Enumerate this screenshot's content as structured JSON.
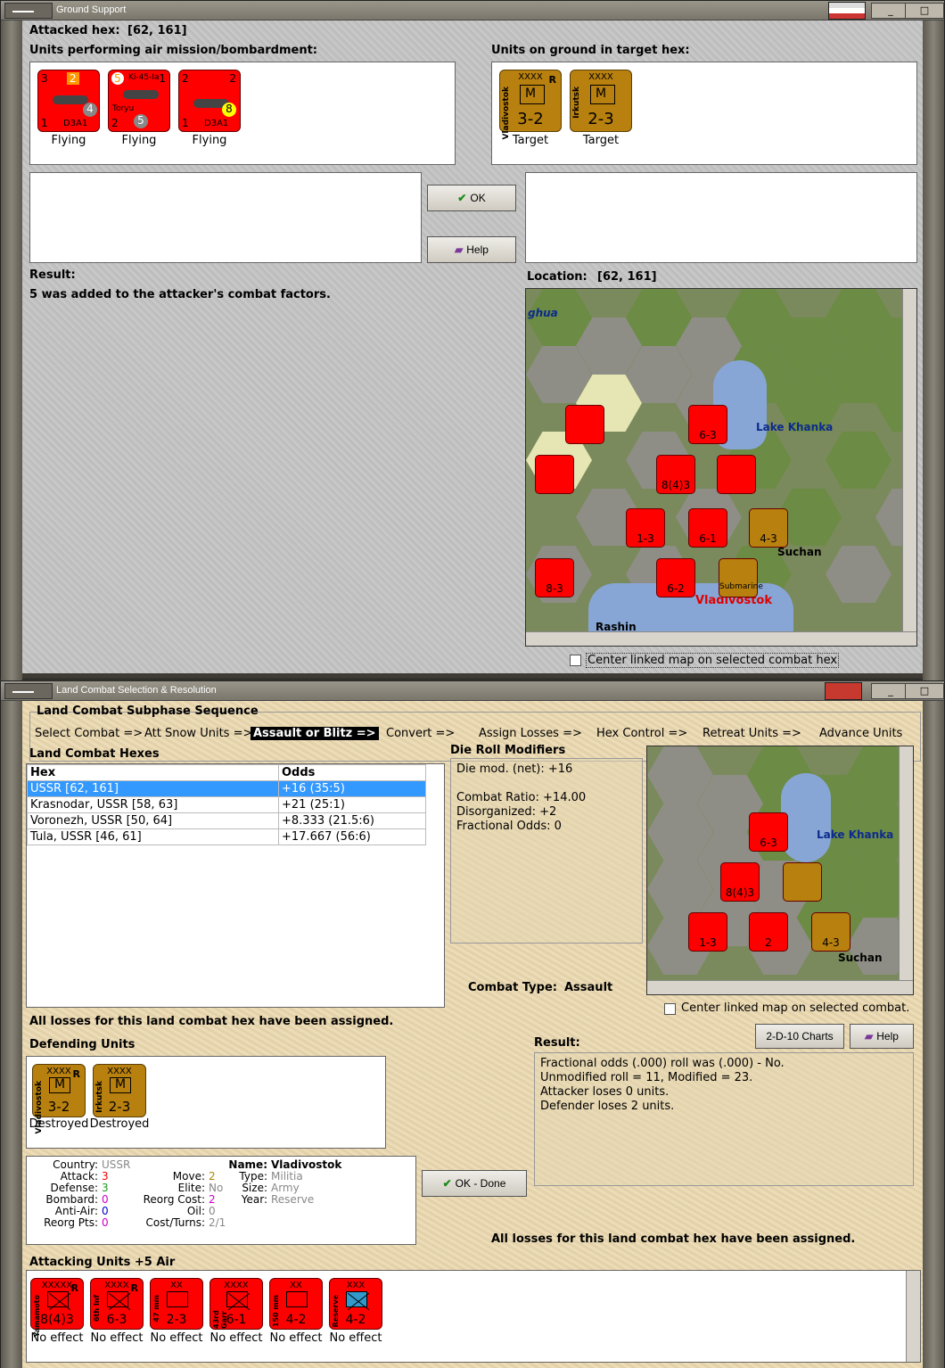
{
  "ground_support": {
    "title": "Ground Support",
    "attacked_hex_label": "Attacked hex:",
    "attacked_hex": "[62, 161]",
    "air_units_label": "Units performing air mission/bombardment:",
    "ground_units_label": "Units on ground in target hex:",
    "air_units": [
      {
        "type": "D3A1",
        "attack": "3",
        "top": "2",
        "defense": "1",
        "pips": "4",
        "caption": "Flying"
      },
      {
        "type": "Ki-45-Ia",
        "subtype": "Toryu",
        "attack": "5",
        "top": "1",
        "defense": "2",
        "pips": "5",
        "caption": "Flying"
      },
      {
        "type": "D3A1",
        "attack": "2",
        "top": "2",
        "defense": "1",
        "pips": "8",
        "caption": "Flying"
      }
    ],
    "ground_units": [
      {
        "name": "Vladivostok",
        "size": "XXXX",
        "flag": "R",
        "symbol": "M",
        "strength": "3-2",
        "caption": "Target"
      },
      {
        "name": "Irkutsk",
        "size": "XXXX",
        "flag": "",
        "symbol": "M",
        "strength": "2-3",
        "caption": "Target"
      }
    ],
    "ok_label": "OK",
    "help_label": "Help",
    "result_label": "Result:",
    "result_text": "5 was added to the attacker's combat factors.",
    "location_label": "Location:",
    "location": "[62, 161]",
    "center_map_label": "Center linked map on selected combat hex",
    "map_labels": {
      "ughua": "ghua",
      "lake": "Lake Khanka",
      "suchan": "Suchan",
      "rashin": "Rashin",
      "vladivostok": "Vladivostok"
    },
    "map_units": [
      "6-3",
      "8(4)3",
      "1-3",
      "6-1",
      "4-3",
      "8-3",
      "6-2",
      "Submarine"
    ]
  },
  "land_combat": {
    "title": "Land Combat Selection & Resolution",
    "sequence_title": "Land Combat Subphase Sequence",
    "sequence": [
      "Select Combat =>",
      "Att Snow Units =>",
      "Assault or Blitz =>",
      "Convert =>",
      "Assign Losses =>",
      "Hex Control =>",
      "Retreat Units =>",
      "Advance Units"
    ],
    "hexes_label": "Land Combat Hexes",
    "table_headers": {
      "hex": "Hex",
      "odds": "Odds"
    },
    "hexes": [
      {
        "hex": "USSR [62, 161]",
        "odds": "+16 (35:5)"
      },
      {
        "hex": "Krasnodar, USSR [58, 63]",
        "odds": "+21 (25:1)"
      },
      {
        "hex": "Voronezh, USSR [50, 64]",
        "odds": "+8.333 (21.5:6)"
      },
      {
        "hex": "Tula, USSR [46, 61]",
        "odds": "+17.667 (56:6)"
      }
    ],
    "drm_label": "Die Roll Modifiers",
    "drm": [
      "Die mod. (net): +16",
      "",
      "Combat Ratio: +14.00",
      "Disorganized: +2",
      "Fractional Odds: 0"
    ],
    "combat_type_label": "Combat Type:",
    "combat_type": "Assault",
    "center_map_label": "Center linked map on selected combat.",
    "charts_label": "2-D-10 Charts",
    "help_label": "Help",
    "losses_msg": "All losses for this land combat hex have been assigned.",
    "defending_label": "Defending Units",
    "defenders": [
      {
        "name": "Vladivostok",
        "size": "XXXX",
        "flag": "R",
        "symbol": "M",
        "strength": "3-2",
        "caption": "Destroyed"
      },
      {
        "name": "Irkutsk",
        "size": "XXXX",
        "flag": "",
        "symbol": "M",
        "strength": "2-3",
        "caption": "Destroyed"
      }
    ],
    "result_label": "Result:",
    "result": [
      "Fractional odds (.000) roll was (.000)  - No.",
      "Unmodified roll = 11, Modified = 23.",
      "Attacker loses 0 units.",
      "Defender loses 2 units."
    ],
    "info": {
      "country_k": "Country:",
      "country": "USSR",
      "attack_k": "Attack:",
      "attack": "3",
      "defense_k": "Defense:",
      "defense": "3",
      "bombard_k": "Bombard:",
      "bombard": "0",
      "antiair_k": "Anti-Air:",
      "antiair": "0",
      "reorgpts_k": "Reorg Pts:",
      "reorgpts": "0",
      "move_k": "Move:",
      "move": "2",
      "elite_k": "Elite:",
      "elite": "No",
      "reorgcost_k": "Reorg Cost:",
      "reorgcost": "2",
      "oil_k": "Oil:",
      "oil": "0",
      "costturns_k": "Cost/Turns:",
      "costturns": "2/1",
      "name_k": "Name:",
      "name": "Vladivostok",
      "type_k": "Type:",
      "type": "Militia",
      "size_k": "Size:",
      "size": "Army",
      "year_k": "Year:",
      "year": "Reserve"
    },
    "ok_done_label": "OK - Done",
    "losses_msg2": "All losses for this land combat hex have been assigned.",
    "attacking_label": "Attacking Units +5 Air",
    "attackers": [
      {
        "name": "Yamamoto",
        "size": "XXXXX",
        "flag": "R",
        "strength": "8(4)3",
        "caption": "No effect"
      },
      {
        "name": "6th Inf",
        "size": "XXXX",
        "flag": "R",
        "strength": "6-3",
        "caption": "No effect"
      },
      {
        "name": "47 mm",
        "size": "XX",
        "flag": "",
        "strength": "2-3",
        "caption": "No effect"
      },
      {
        "name": "43rd Garr",
        "size": "XXXX",
        "flag": "",
        "strength": "6-1",
        "caption": "No effect"
      },
      {
        "name": "150 mm",
        "size": "XX",
        "flag": "",
        "strength": "4-2",
        "caption": "No effect"
      },
      {
        "name": "Reserve",
        "size": "XXX",
        "flag": "",
        "strength": "4-2",
        "caption": "No effect"
      }
    ],
    "map_labels": {
      "lake": "Lake Khanka",
      "suchan": "Suchan"
    },
    "map_units": [
      "6-3",
      "8(4)3",
      "1-3",
      "2",
      "4-3"
    ]
  },
  "colors": {
    "unit_red": "#ff0000",
    "unit_brown": "#b8800e",
    "selection": "#3399ff",
    "map_text": "#0c2b8c",
    "city_text": "#e00000"
  }
}
